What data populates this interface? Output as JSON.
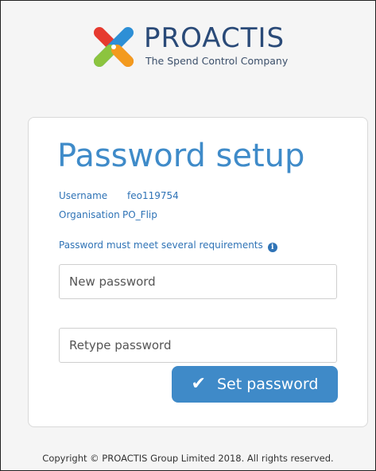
{
  "logo": {
    "brand": "PROACTIS",
    "tagline": "The Spend Control Company",
    "colors": [
      "#e63a2f",
      "#f39a1e",
      "#8cc43f",
      "#2d8fd6"
    ]
  },
  "form": {
    "title": "Password setup",
    "username_label": "Username",
    "username_value": "feo119754",
    "organisation_label": "Organisation",
    "organisation_value": "PO_Flip",
    "requirements_text": "Password must meet several requirements",
    "new_password_placeholder": "New password",
    "retype_password_placeholder": "Retype password",
    "submit_label": "Set password",
    "accent_color": "#3f8ac8"
  },
  "footer": {
    "copyright": "Copyright © PROACTIS Group Limited 2018. All rights reserved."
  }
}
